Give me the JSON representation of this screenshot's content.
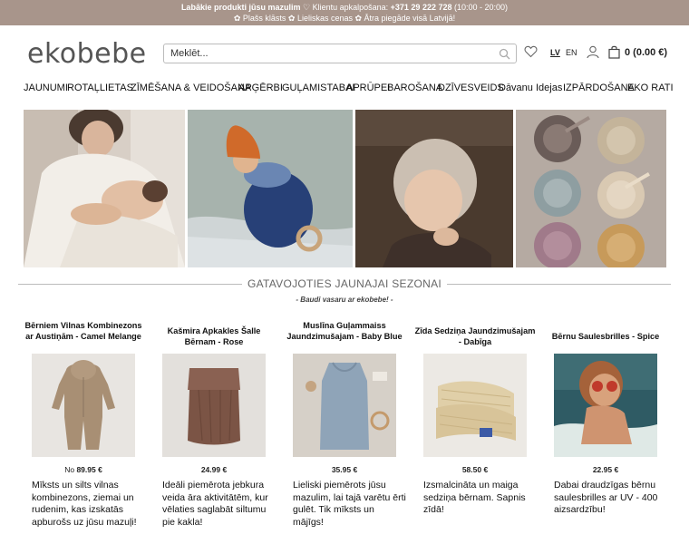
{
  "topbar": {
    "line1_strong": "Labākie produkti jūsu mazulim",
    "line1_sep": "♡",
    "line1_support": "Klientu apkalpošana:",
    "line1_phone": "+371 29 222 728",
    "line1_hours": "(10:00 - 20:00)",
    "line2": "✿ Plašs klāsts  ✿ Lieliskas cenas ✿ Ātra piegāde visā Latvijā!"
  },
  "header": {
    "logo": "ekobebe",
    "search_placeholder": "Meklēt...",
    "lang_lv": "LV",
    "lang_en": "EN",
    "cart_total": "0 (0.00 €)"
  },
  "nav": [
    {
      "label": "JAUNUMI"
    },
    {
      "label": "ROTAĻLIETAS"
    },
    {
      "label": "ZĪMĒŠANA & VEIDOŠANA"
    },
    {
      "label": "APĢĒRBI"
    },
    {
      "label": "GUĻAMISTABAI"
    },
    {
      "label": "APRŪPEI"
    },
    {
      "label": "BAROŠANA"
    },
    {
      "label": "DZĪVESVEIDS"
    },
    {
      "label": "Dāvanu Idejas"
    },
    {
      "label": "IZPĀRDOŠANA"
    },
    {
      "label": "EKO RATI"
    }
  ],
  "section": {
    "title": "GATAVOJOTIES JAUNAJAI SEZONAI",
    "subtitle": "- Baudi vasaru ar ekobebe! -"
  },
  "products": [
    {
      "title": "Bērniem Vilnas Kombinezons ar Austiņām - Camel Melange",
      "price_prefix": "No",
      "price": "89.95 €",
      "desc": "Mīksts un silts vilnas kombinezons, ziemai un rudenim, kas izskatās apburošs uz jūsu mazuļi!"
    },
    {
      "title": "Kašmira Apkakles Šalle Bērnam - Rose",
      "price_prefix": "",
      "price": "24.99 €",
      "desc": "Ideāli piemērota jebkura veida āra aktivitātēm, kur vēlaties saglabāt siltumu pie kakla!"
    },
    {
      "title": "Muslīna Guļammaiss Jaundzimušajam - Baby Blue",
      "price_prefix": "",
      "price": "35.95 €",
      "desc": "Lieliski piemērots jūsu mazulim, lai tajā varētu ērti gulēt. Tik mīksts un mājīgs!"
    },
    {
      "title": "Zīda Sedziņa Jaundzimušajam - Dabīga",
      "price_prefix": "",
      "price": "58.50 €",
      "desc": "Izsmalcināta un maiga sedziņa bērnam. Sapnis zīdā!"
    },
    {
      "title": "Bērnu Saulesbrilles - Spice",
      "price_prefix": "",
      "price": "22.95 €",
      "desc": "Dabai draudzīgas bērnu saulesbrilles ar UV - 400 aizsardzību!"
    }
  ],
  "colors": {
    "topbar_bg": "#a8958b",
    "text": "#222222"
  }
}
